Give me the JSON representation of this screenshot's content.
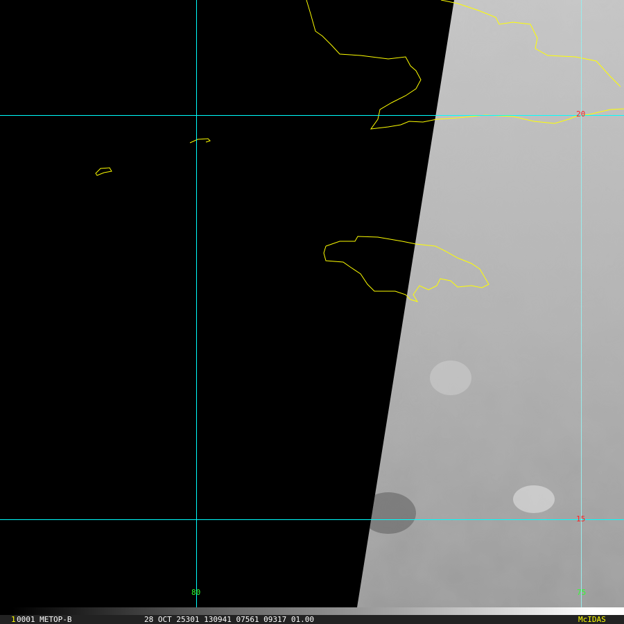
{
  "image": {
    "satellite_label": "0001 METOP-B",
    "frame_marker": "1",
    "info": "28 OCT 25301 130941 07561 09317 01.00",
    "brand": "McIDAS"
  },
  "grid": {
    "lat_labels": [
      "20",
      "15"
    ],
    "lon_labels": [
      "80",
      "75"
    ]
  },
  "colors": {
    "grid": "#00ffff",
    "coastline": "#ffff00",
    "lat_label": "#ff2020",
    "lon_label": "#30ff30",
    "brand": "#ffff00"
  }
}
